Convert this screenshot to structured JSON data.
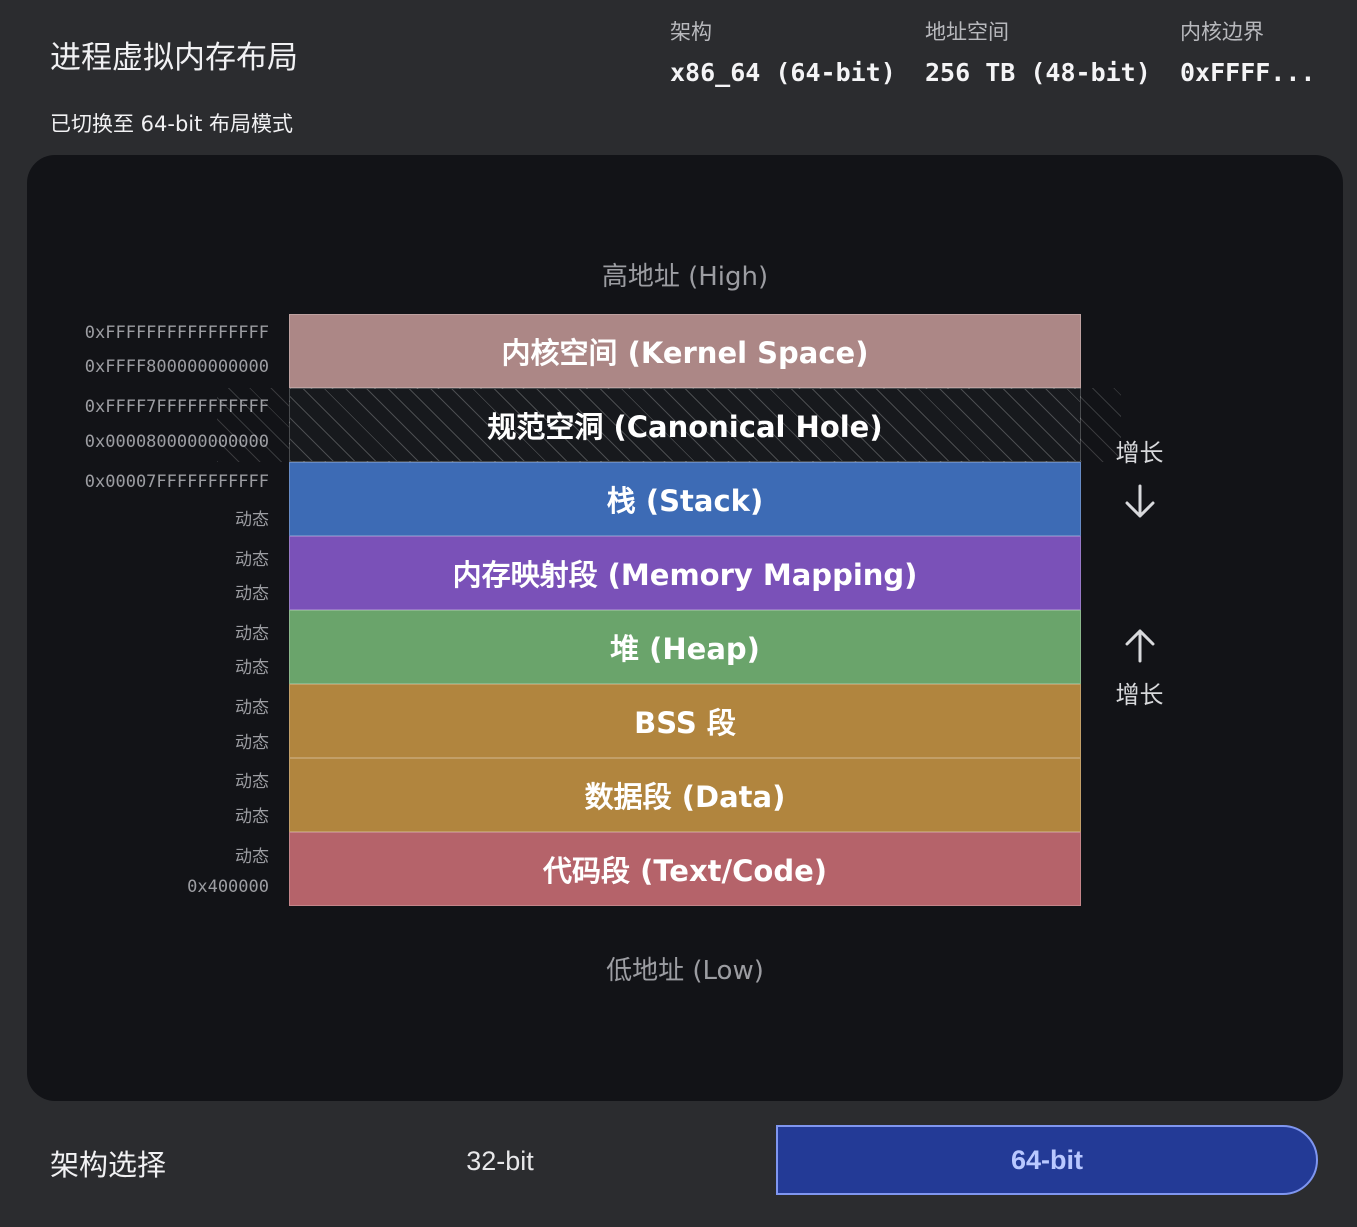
{
  "header": {
    "title": "进程虚拟内存布局",
    "subtitle": "已切换至 64-bit 布局模式",
    "stats": [
      {
        "label": "架构",
        "value": "x86_64 (64-bit)"
      },
      {
        "label": "地址空间",
        "value": "256 TB (48-bit)"
      },
      {
        "label": "内核边界",
        "value": "0xFFFF..."
      }
    ]
  },
  "diagram": {
    "high_label": "高地址 (High)",
    "low_label": "低地址 (Low)",
    "addresses": [
      "0xFFFFFFFFFFFFFFFF",
      "0xFFFF800000000000",
      "0xFFFF7FFFFFFFFFFF",
      "0x0000800000000000",
      "0x00007FFFFFFFFFFF",
      "动态",
      "动态",
      "动态",
      "动态",
      "动态",
      "动态",
      "动态",
      "动态",
      "动态",
      "动态",
      "0x400000"
    ],
    "segments": [
      {
        "label": "内核空间 (Kernel Space)",
        "color": "#ac8786"
      },
      {
        "label": "规范空洞 (Canonical Hole)",
        "color": "#17191d",
        "pattern": "hatched"
      },
      {
        "label": "栈 (Stack)",
        "color": "#3d6bb5"
      },
      {
        "label": "内存映射段 (Memory Mapping)",
        "color": "#7a51b8"
      },
      {
        "label": "堆 (Heap)",
        "color": "#6aa46b"
      },
      {
        "label": "BSS 段",
        "color": "#b1853e"
      },
      {
        "label": "数据段 (Data)",
        "color": "#b1853e"
      },
      {
        "label": "代码段 (Text/Code)",
        "color": "#b5636a"
      }
    ],
    "stack_growth": {
      "label": "增长",
      "direction": "down",
      "icon": "arrow-down-icon"
    },
    "heap_growth": {
      "label": "增长",
      "direction": "up",
      "icon": "arrow-up-icon"
    }
  },
  "footer": {
    "label": "架构选择",
    "options": [
      "32-bit",
      "64-bit"
    ],
    "selected": "64-bit",
    "accent": "#233a96"
  }
}
